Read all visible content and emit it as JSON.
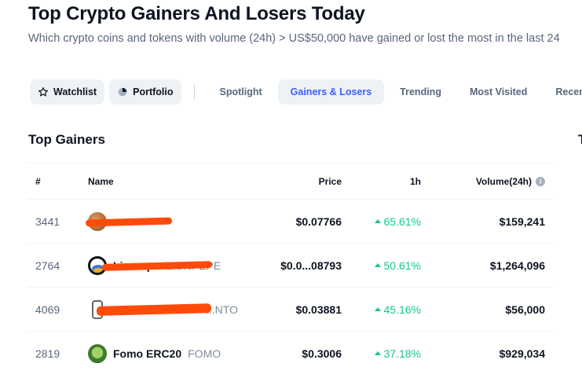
{
  "page": {
    "title": "Top Crypto Gainers And Losers Today",
    "subtitle": "Which crypto coins and tokens with volume (24h) > US$50,000 have gained or lost the most in the last 24"
  },
  "nav": {
    "watchlist_label": "Watchlist",
    "portfolio_label": "Portfolio",
    "tabs": [
      {
        "label": "Spotlight",
        "active": false
      },
      {
        "label": "Gainers & Losers",
        "active": true
      },
      {
        "label": "Trending",
        "active": false
      },
      {
        "label": "Most Visited",
        "active": false
      },
      {
        "label": "Recently A",
        "active": false
      }
    ]
  },
  "gainers": {
    "title": "Top Gainers",
    "columns": {
      "rank": "#",
      "name": "Name",
      "price": "Price",
      "change_1h": "1h",
      "volume": "Volume(24h)"
    },
    "rows": [
      {
        "rank": "3441",
        "name": "",
        "symbol": "",
        "price": "$0.07766",
        "change_1h": "65.61%",
        "volume": "$159,241"
      },
      {
        "rank": "2764",
        "name": "Lionrepe",
        "symbol": "LIONPEPE",
        "price": "$0.0...08793",
        "change_1h": "50.61%",
        "volume": "$1,264,096"
      },
      {
        "rank": "4069",
        "name": "",
        "symbol": "...NTO",
        "price": "$0.03881",
        "change_1h": "45.16%",
        "volume": "$56,000"
      },
      {
        "rank": "2819",
        "name": "Fomo ERC20",
        "symbol": "FOMO",
        "price": "$0.3006",
        "change_1h": "37.18%",
        "volume": "$929,034"
      }
    ]
  },
  "losers": {
    "title": "T"
  },
  "colors": {
    "accent": "#3861fb",
    "positive": "#16c784",
    "redaction": "#ff4b0a"
  }
}
